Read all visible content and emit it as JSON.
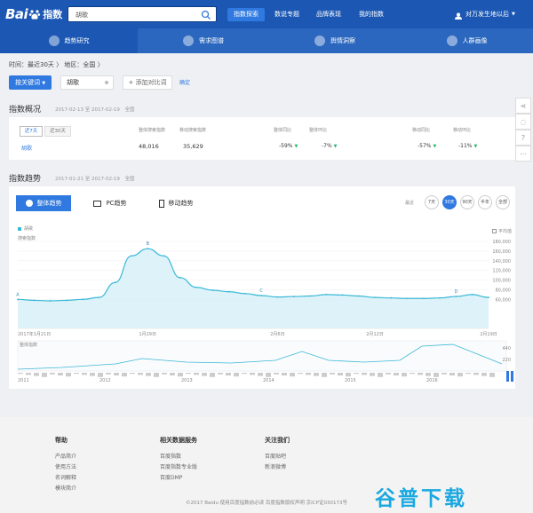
{
  "header": {
    "logo_text": "Bai",
    "logo_sub": "指数",
    "search_value": "胡歌",
    "nav": [
      "指数探索",
      "数说专题",
      "品牌表现",
      "我的指数"
    ],
    "user": "对万发生地以后"
  },
  "subnav": [
    "趋势研究",
    "需求图谱",
    "舆情洞察",
    "人群画像"
  ],
  "filter": {
    "text": "时间：最近30天 〉 地区：全国 〉",
    "kw_button": "按关键词",
    "keyword": "胡歌",
    "add_compare": "+ 添加对比词",
    "confirm": "确定"
  },
  "overview": {
    "title": "指数概况",
    "date_range": "2017-02-13 至 2017-02-19",
    "region": "全国",
    "tabs": [
      "近7天",
      "近30天"
    ],
    "keyword": "胡歌",
    "headers": [
      "整体搜索指数",
      "移动搜索指数",
      "整体同比",
      "整体环比",
      "移动同比",
      "移动环比"
    ],
    "values": {
      "overall": "48,016",
      "mobile": "35,629",
      "overall_yoy": "-59%",
      "overall_mom": "-7%",
      "mobile_yoy": "-57%",
      "mobile_mom": "-11%"
    }
  },
  "trend": {
    "title": "指数趋势",
    "date_range": "2017-01-21 至 2017-02-19",
    "region": "全国",
    "tabs": [
      "整体趋势",
      "PC趋势",
      "移动趋势"
    ],
    "ranges": [
      "最近",
      "7天",
      "30天",
      "90天",
      "半年",
      "全部"
    ],
    "legend": "胡歌",
    "avg_label": "平均值",
    "ylabel": "搜索指数"
  },
  "chart_data": {
    "type": "line",
    "title": "",
    "xlabel": "",
    "ylabel": "搜索指数",
    "legend": "胡歌",
    "ylim": [
      0,
      180000
    ],
    "y_ticks": [
      "180,000",
      "160,000",
      "140,000",
      "120,000",
      "100,000",
      "80,000",
      "60,000"
    ],
    "x_ticks": [
      "2017年1月21日",
      "1月29日",
      "2月6日",
      "2月12日",
      "2月19日"
    ],
    "x": [
      "01-21",
      "01-22",
      "01-23",
      "01-24",
      "01-25",
      "01-26",
      "01-27",
      "01-28",
      "01-29",
      "01-30",
      "01-31",
      "02-01",
      "02-02",
      "02-03",
      "02-04",
      "02-05",
      "02-06",
      "02-07",
      "02-08",
      "02-09",
      "02-10",
      "02-11",
      "02-12",
      "02-13",
      "02-14",
      "02-15",
      "02-16",
      "02-17",
      "02-18",
      "02-19"
    ],
    "series": [
      {
        "name": "胡歌",
        "values": [
          60000,
          58000,
          57000,
          58000,
          60000,
          64000,
          95000,
          150000,
          165000,
          150000,
          105000,
          85000,
          79000,
          76000,
          72000,
          68000,
          65000,
          66000,
          67000,
          70000,
          69000,
          67000,
          64000,
          63000,
          62000,
          62000,
          63000,
          66000,
          70000,
          64000
        ]
      }
    ],
    "annotations": [
      "A",
      "B",
      "C",
      "D"
    ],
    "overview_axis": {
      "years": [
        "2011",
        "2012",
        "2013",
        "2014",
        "2015",
        "2016"
      ],
      "labels": [
        "整体指数",
        "440",
        "220"
      ]
    }
  },
  "sidebar": [
    "share",
    "hide",
    "help",
    "more"
  ],
  "footer": {
    "cols": [
      {
        "title": "帮助",
        "items": [
          "产品简介",
          "使用方法",
          "名词解释",
          "模块简介"
        ]
      },
      {
        "title": "相关数据服务",
        "items": [
          "百度指数",
          "百度指数专业版",
          "百度DMP"
        ]
      },
      {
        "title": "关注我们",
        "items": [
          "百度贴吧",
          "新浪微博"
        ]
      }
    ],
    "copyright": "©2017 Baidu  使用百度指数前必读  百度指数版权声明  京ICP证030173号",
    "watermark": "谷普下载"
  }
}
